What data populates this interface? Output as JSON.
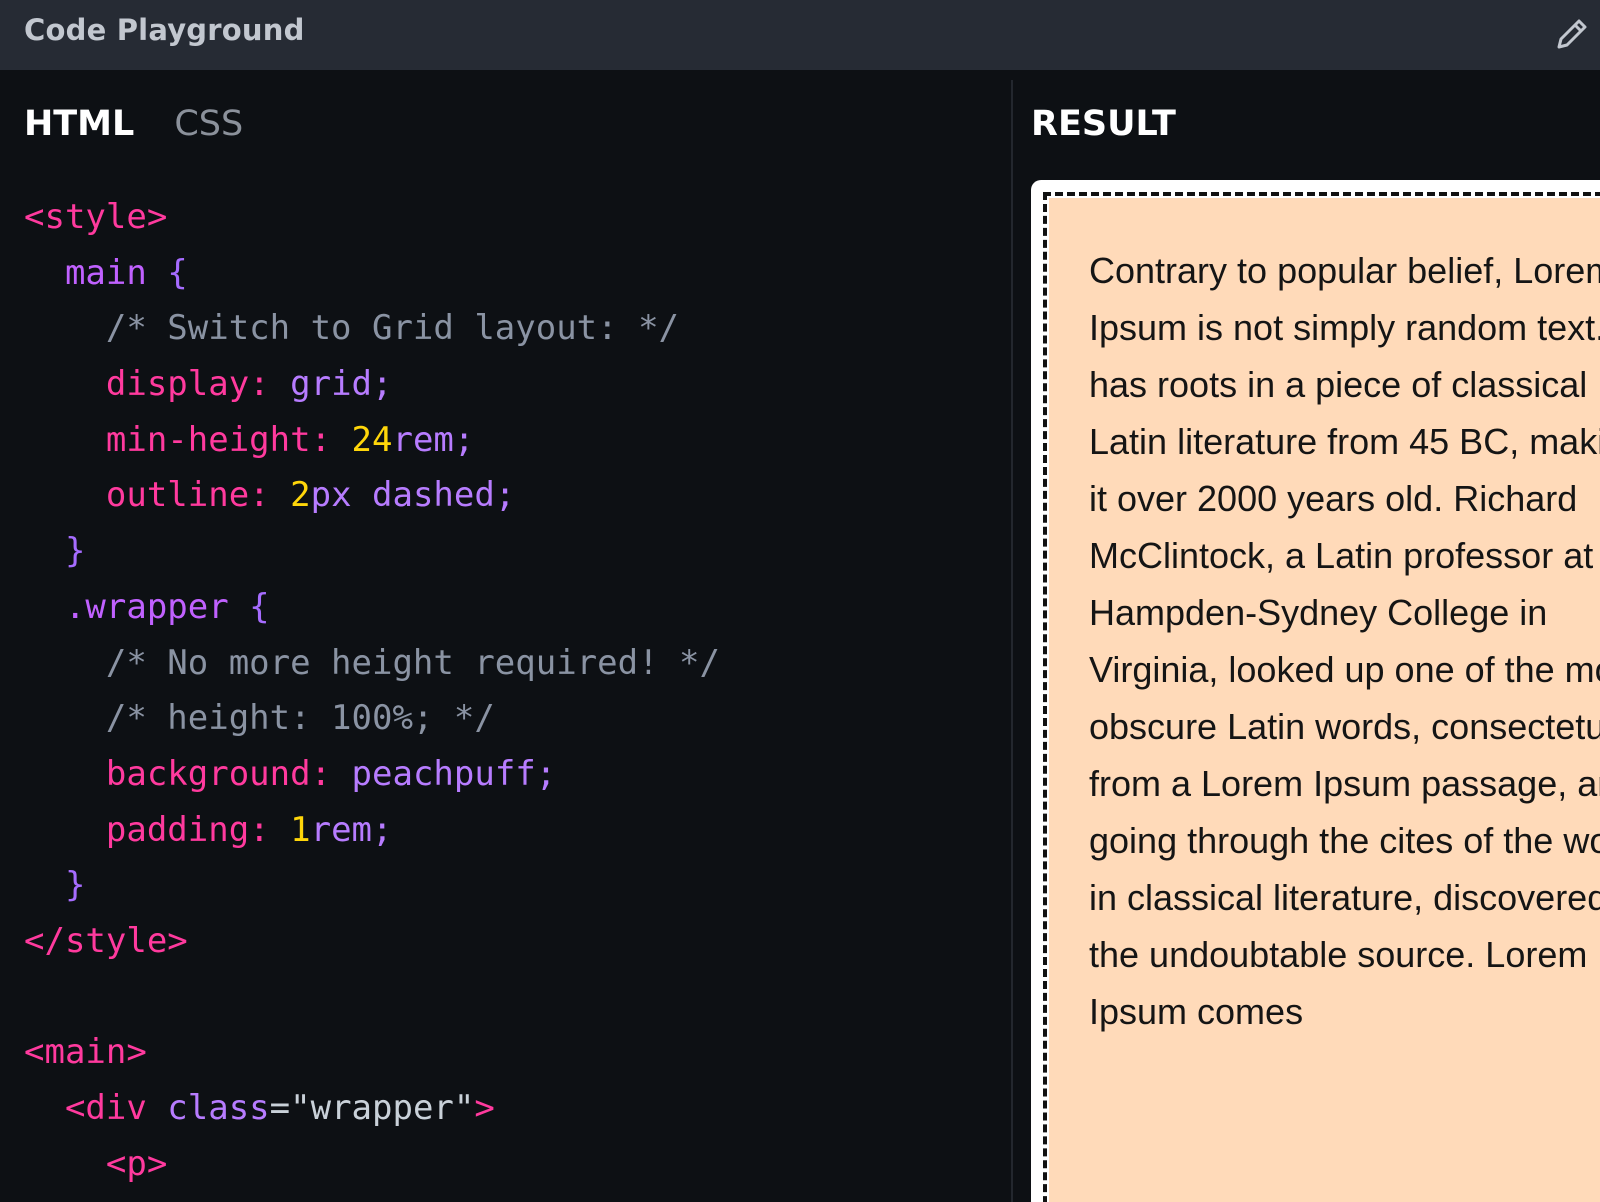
{
  "app": {
    "title": "Code Playground",
    "edit_icon": "pencil-icon"
  },
  "editor": {
    "tabs": [
      {
        "label": "HTML",
        "active": true
      },
      {
        "label": "CSS",
        "active": false
      }
    ],
    "code_lines": [
      [
        [
          "tag",
          "<style>"
        ]
      ],
      [
        [
          "sel",
          "  main "
        ],
        [
          "punc",
          "{"
        ]
      ],
      [
        [
          "comment",
          "    /* Switch to Grid layout: */"
        ]
      ],
      [
        [
          "prop",
          "    display"
        ],
        [
          "prop",
          ": "
        ],
        [
          "val",
          "grid;"
        ]
      ],
      [
        [
          "prop",
          "    min-height"
        ],
        [
          "prop",
          ": "
        ],
        [
          "num",
          "24"
        ],
        [
          "val",
          "rem;"
        ]
      ],
      [
        [
          "prop",
          "    outline"
        ],
        [
          "prop",
          ": "
        ],
        [
          "num",
          "2"
        ],
        [
          "val",
          "px dashed;"
        ]
      ],
      [
        [
          "punc",
          "  }"
        ]
      ],
      [
        [
          "sel",
          "  .wrapper "
        ],
        [
          "punc",
          "{"
        ]
      ],
      [
        [
          "comment",
          "    /* No more height required! */"
        ]
      ],
      [
        [
          "comment",
          "    /* height: 100%; */"
        ]
      ],
      [
        [
          "prop",
          "    background"
        ],
        [
          "prop",
          ": "
        ],
        [
          "val",
          "peachpuff;"
        ]
      ],
      [
        [
          "prop",
          "    padding"
        ],
        [
          "prop",
          ": "
        ],
        [
          "num",
          "1"
        ],
        [
          "val",
          "rem;"
        ]
      ],
      [
        [
          "punc",
          "  }"
        ]
      ],
      [
        [
          "tag",
          "</style>"
        ]
      ],
      [
        [
          "str",
          ""
        ]
      ],
      [
        [
          "tag",
          "<main>"
        ]
      ],
      [
        [
          "tag",
          "  <div "
        ],
        [
          "attr",
          "class"
        ],
        [
          "str",
          "=\"wrapper\""
        ],
        [
          "tag",
          ">"
        ]
      ],
      [
        [
          "tag",
          "    <p>"
        ]
      ]
    ]
  },
  "result": {
    "title": "RESULT",
    "paragraph": "Contrary to popular belief, Lorem Ipsum is not simply random text. It has roots in a piece of classical Latin literature from 45 BC, making it over 2000 years old. Richard McClintock, a Latin professor at Hampden-Sydney College in Virginia, looked up one of the more obscure Latin words, consectetur, from a Lorem Ipsum passage, and going through the cites of the word in classical literature, discovered the undoubtable source. Lorem Ipsum comes"
  }
}
